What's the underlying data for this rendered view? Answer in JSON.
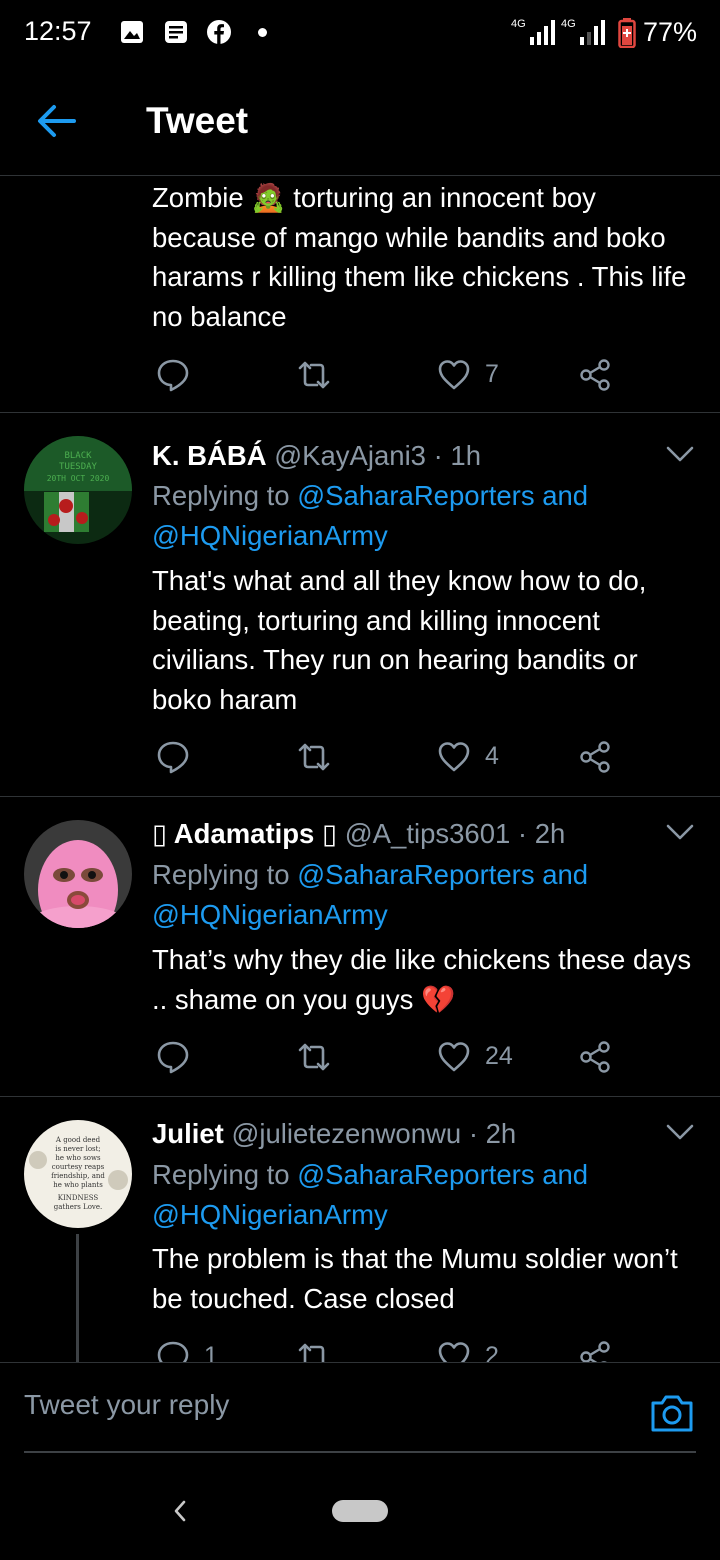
{
  "status_bar": {
    "time": "12:57",
    "notification_icons": [
      "image-icon",
      "message-icon",
      "facebook-icon",
      "dot-icon"
    ],
    "network": "4G",
    "battery": "77%"
  },
  "header": {
    "back_icon": "arrow-left-icon",
    "title": "Tweet"
  },
  "colors": {
    "accent": "#1d9bf0",
    "muted": "#8b98a5",
    "text": "#ffffff",
    "divider": "#2f3336",
    "battery_red": "#e0463f"
  },
  "tweets": [
    {
      "text": "Zombie 🧟 torturing an innocent boy because of mango while bandits and boko harams r killing them like chickens . This life no balance",
      "actions": {
        "reply": "",
        "retweet": "",
        "like": "7"
      }
    },
    {
      "name": "K. BÁBÁ",
      "handle": "@KayAjani3 · 1h",
      "replying_prefix": "Replying to ",
      "mention_1": "@SaharaReporters",
      "and": " and ",
      "mention_2": "@HQNigerianArmy",
      "avatar_text": [
        "BLACK",
        "TUESDAY",
        "20TH OCT 2020"
      ],
      "text": "That's what and all they know how to do, beating, torturing and killing innocent civilians. They run on hearing bandits or boko haram",
      "actions": {
        "reply": "",
        "retweet": "",
        "like": "4"
      }
    },
    {
      "name": "▯ Adamatips ▯",
      "handle": "@A_tips3601 · 2h",
      "replying_prefix": "Replying to ",
      "mention_1": "@SaharaReporters",
      "and": " and ",
      "mention_2": "@HQNigerianArmy",
      "text": "That’s why they die like chickens these days .. shame on you guys 💔",
      "actions": {
        "reply": "",
        "retweet": "",
        "like": "24"
      }
    },
    {
      "name": "Juliet",
      "handle": "@julietezenwonwu · 2h",
      "replying_prefix": "Replying to ",
      "mention_1": "@SaharaReporters",
      "and": " and ",
      "mention_2": "@HQNigerianArmy",
      "avatar_text": [
        "A good deed",
        "is never lost;",
        "he who sows",
        "courtesy reaps",
        "friendship, and",
        "he who plants",
        "KINDNESS",
        "gathers Love."
      ],
      "text": "The problem is that the Mumu soldier won’t be touched. Case closed",
      "actions": {
        "reply": "1",
        "retweet": "",
        "like": "2"
      }
    }
  ],
  "composer": {
    "placeholder": "Tweet your reply",
    "camera_icon": "camera-icon"
  },
  "nav_bar": {
    "back_icon": "nav-back-icon",
    "home_icon": "home-pill-icon"
  }
}
